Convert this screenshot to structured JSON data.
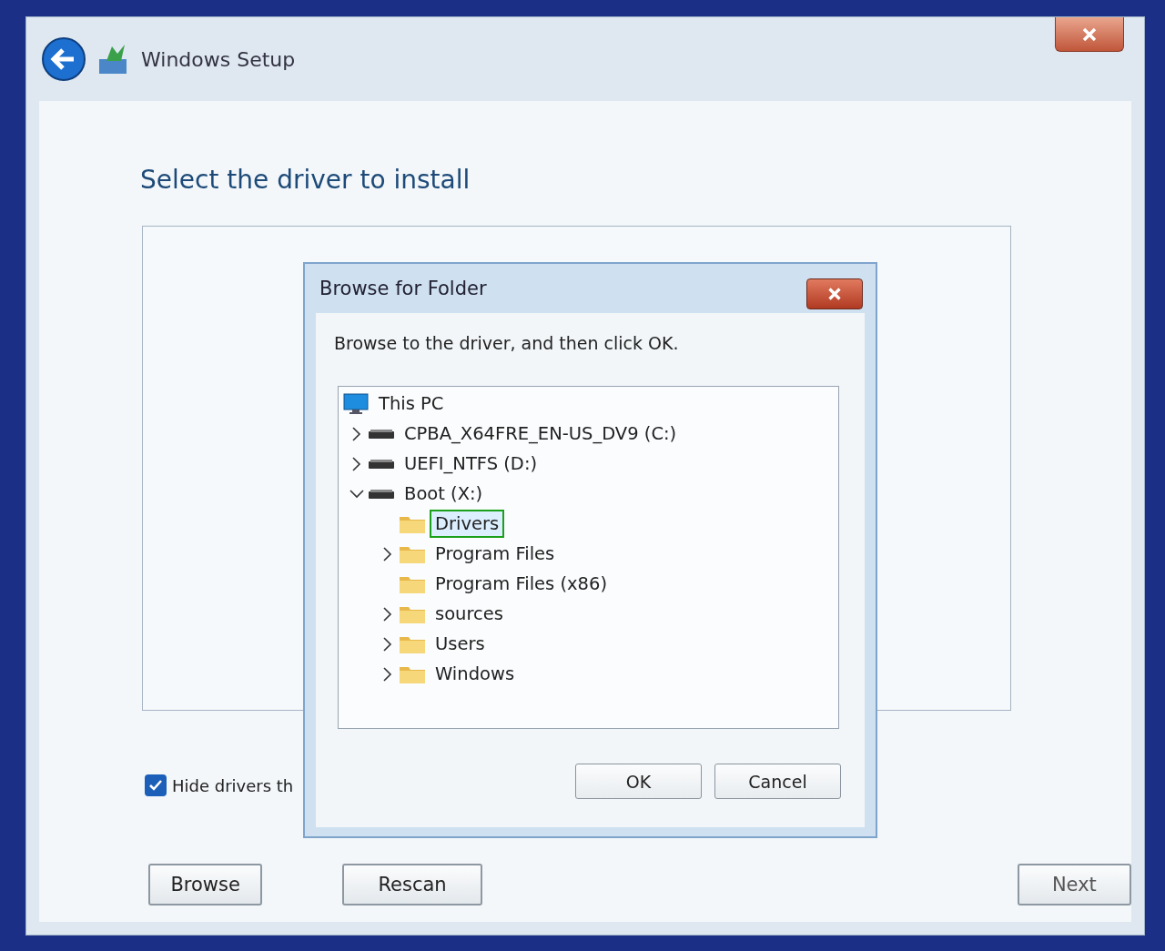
{
  "window": {
    "title": "Windows Setup"
  },
  "heading": "Select the driver to install",
  "hide_checkbox": {
    "label": "Hide drivers th",
    "checked": true
  },
  "buttons": [
    {
      "label": "Browse"
    },
    {
      "label": "Rescan"
    },
    {
      "label": "Next"
    }
  ],
  "dialog": {
    "title": "Browse for Folder",
    "instruction": "Browse to the driver, and then click OK.",
    "tree": [
      {
        "label": "This PC",
        "kind": "computer",
        "selected": false,
        "children": [
          {
            "label": "CPBA_X64FRE_EN-US_DV9 (C:)",
            "kind": "drive",
            "expanded": false,
            "selected": false
          },
          {
            "label": "UEFI_NTFS (D:)",
            "kind": "drive",
            "expanded": false,
            "selected": false
          },
          {
            "label": "Boot (X:)",
            "kind": "drive",
            "expanded": true,
            "selected": false,
            "children": [
              {
                "label": "Drivers",
                "kind": "folder",
                "selected": true
              },
              {
                "label": "Program Files",
                "kind": "folder",
                "expanded": false,
                "selected": false
              },
              {
                "label": "Program Files (x86)",
                "kind": "folder",
                "selected": false
              },
              {
                "label": "sources",
                "kind": "folder",
                "expanded": false,
                "selected": false
              },
              {
                "label": "Users",
                "kind": "folder",
                "expanded": false,
                "selected": false
              },
              {
                "label": "Windows",
                "kind": "folder",
                "expanded": false,
                "selected": false
              }
            ]
          }
        ]
      }
    ],
    "buttons": [
      {
        "label": "OK"
      },
      {
        "label": "Cancel"
      }
    ]
  }
}
